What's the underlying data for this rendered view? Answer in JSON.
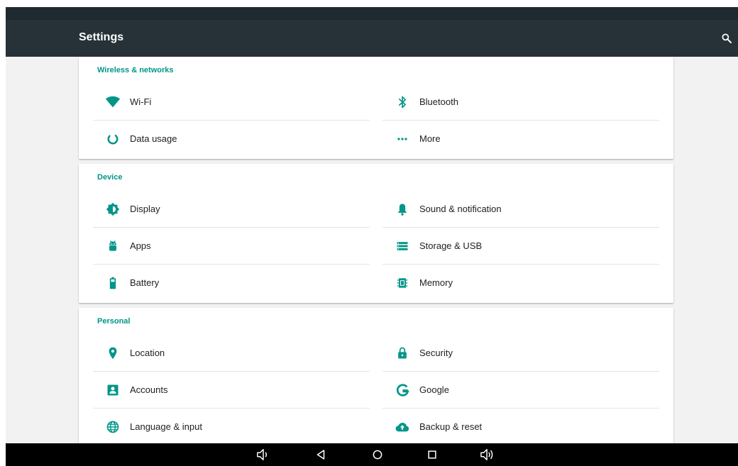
{
  "toolbar": {
    "title": "Settings"
  },
  "accent_color": "#009688",
  "sections": [
    {
      "title": "Wireless & networks",
      "items": [
        {
          "label": "Wi-Fi",
          "icon": "wifi-icon"
        },
        {
          "label": "Bluetooth",
          "icon": "bluetooth-icon"
        },
        {
          "label": "Data usage",
          "icon": "data-usage-icon"
        },
        {
          "label": "More",
          "icon": "more-icon"
        }
      ]
    },
    {
      "title": "Device",
      "items": [
        {
          "label": "Display",
          "icon": "display-icon"
        },
        {
          "label": "Sound & notification",
          "icon": "bell-icon"
        },
        {
          "label": "Apps",
          "icon": "android-icon"
        },
        {
          "label": "Storage & USB",
          "icon": "storage-icon"
        },
        {
          "label": "Battery",
          "icon": "battery-icon"
        },
        {
          "label": "Memory",
          "icon": "memory-icon"
        }
      ]
    },
    {
      "title": "Personal",
      "items": [
        {
          "label": "Location",
          "icon": "location-icon"
        },
        {
          "label": "Security",
          "icon": "lock-icon"
        },
        {
          "label": "Accounts",
          "icon": "account-icon"
        },
        {
          "label": "Google",
          "icon": "google-icon"
        },
        {
          "label": "Language & input",
          "icon": "globe-icon"
        },
        {
          "label": "Backup & reset",
          "icon": "cloud-upload-icon"
        }
      ]
    }
  ],
  "nav_bar": [
    {
      "icon": "volume-down-icon"
    },
    {
      "icon": "back-icon"
    },
    {
      "icon": "home-icon"
    },
    {
      "icon": "recents-icon"
    },
    {
      "icon": "volume-up-icon"
    }
  ]
}
